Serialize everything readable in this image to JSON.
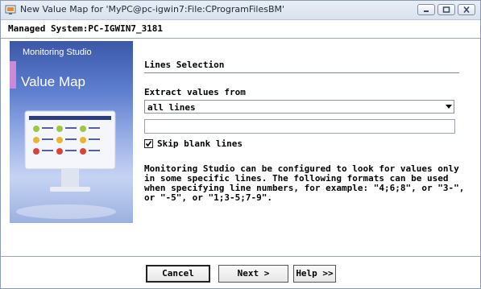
{
  "window": {
    "title": "New Value Map for 'MyPC@pc-igwin7:File:CProgramFilesBM'",
    "controls": [
      "minimize",
      "maximize",
      "close"
    ]
  },
  "header": {
    "managed_system": "Managed System:PC-IGWIN7_3181"
  },
  "side_panel": {
    "brand": "Monitoring Studio",
    "product": "Value Map"
  },
  "main": {
    "section_title": "Lines Selection",
    "extract_label": "Extract values from",
    "extract_select": {
      "value": "all lines"
    },
    "line_filter_input": {
      "value": "",
      "placeholder": ""
    },
    "skip_blank": {
      "label": "Skip blank lines",
      "checked": true
    },
    "description": "Monitoring Studio can be configured to look for values only\nin some specific lines. The following formats can be used\nwhen specifying line numbers, for example: \"4;6;8\", or \"3-\",\nor \"-5\", or \"1;3-5;7-9\"."
  },
  "footer": {
    "cancel_label": "Cancel",
    "next_label": "Next >",
    "help_label": "Help >>"
  },
  "colors": {
    "title_bar": "#dfe6f0",
    "panel_blue": "#5f7fd0",
    "accent_purple": "#c98ad8"
  }
}
